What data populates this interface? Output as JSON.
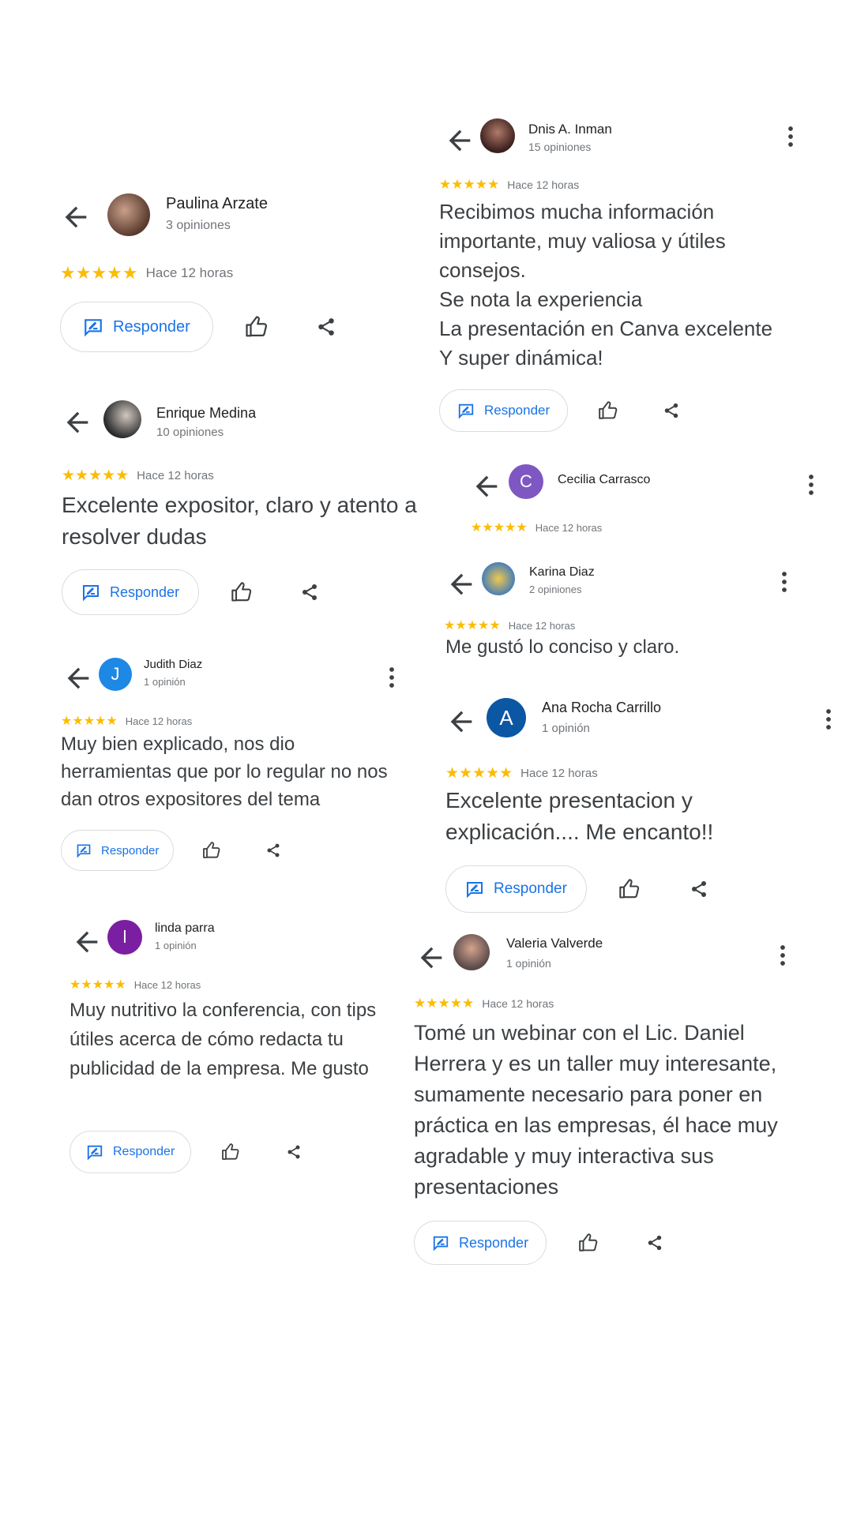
{
  "reviews": [
    {
      "name": "Paulina Arzate",
      "count": "3 opiniones",
      "stars": "★★★★★",
      "time": "Hace 12 horas",
      "text": "",
      "reply_label": "Responder"
    },
    {
      "name": "Dnis A. Inman",
      "count": "15 opiniones",
      "stars": "★★★★★",
      "time": "Hace 12 horas",
      "text": "Recibimos mucha información importante, muy valiosa y útiles consejos.\nSe nota la experiencia\nLa presentación en Canva excelente\nY super dinámica!",
      "reply_label": "Responder"
    },
    {
      "name": "Enrique Medina",
      "count": "10 opiniones",
      "stars": "★★★★★",
      "time": "Hace 12 horas",
      "text": "Excelente expositor, claro y atento a resolver dudas",
      "reply_label": "Responder"
    },
    {
      "name": "Cecilia Carrasco",
      "count": "",
      "initial": "C",
      "stars": "★★★★★",
      "time": "Hace 12 horas",
      "text": ""
    },
    {
      "name": "Karina Diaz",
      "count": "2 opiniones",
      "stars": "★★★★★",
      "time": "Hace 12 horas",
      "text": "Me gustó lo conciso y claro."
    },
    {
      "name": "Judith Diaz",
      "count": "1 opinión",
      "initial": "J",
      "stars": "★★★★★",
      "time": "Hace 12 horas",
      "text": "Muy bien explicado, nos dio herramientas que por lo regular no nos dan otros expositores del tema",
      "reply_label": "Responder"
    },
    {
      "name": "Ana Rocha Carrillo",
      "count": "1 opinión",
      "initial": "A",
      "stars": "★★★★★",
      "time": "Hace 12 horas",
      "text": "Excelente presentacion y explicación.... Me encanto!!",
      "reply_label": "Responder"
    },
    {
      "name": "linda parra",
      "count": "1 opinión",
      "initial": "l",
      "stars": "★★★★★",
      "time": "Hace 12 horas",
      "text": "Muy nutritivo la conferencia, con tips útiles acerca de cómo redacta tu publicidad de la empresa. Me gusto",
      "reply_label": "Responder"
    },
    {
      "name": "Valeria Valverde",
      "count": "1 opinión",
      "stars": "★★★★★",
      "time": "Hace 12 horas",
      "text": "Tomé un webinar con el Lic. Daniel Herrera y es un taller muy interesante, sumamente necesario para poner en práctica en las empresas, él hace muy agradable y muy interactiva sus presentaciones",
      "reply_label": "Responder"
    }
  ],
  "colors": {
    "star": "#fbbc04",
    "link": "#1a73e8",
    "avatar_c": "#7e57c2",
    "avatar_j": "#1e88e5",
    "avatar_a": "#0b57a4",
    "avatar_l": "#7b1fa2"
  }
}
